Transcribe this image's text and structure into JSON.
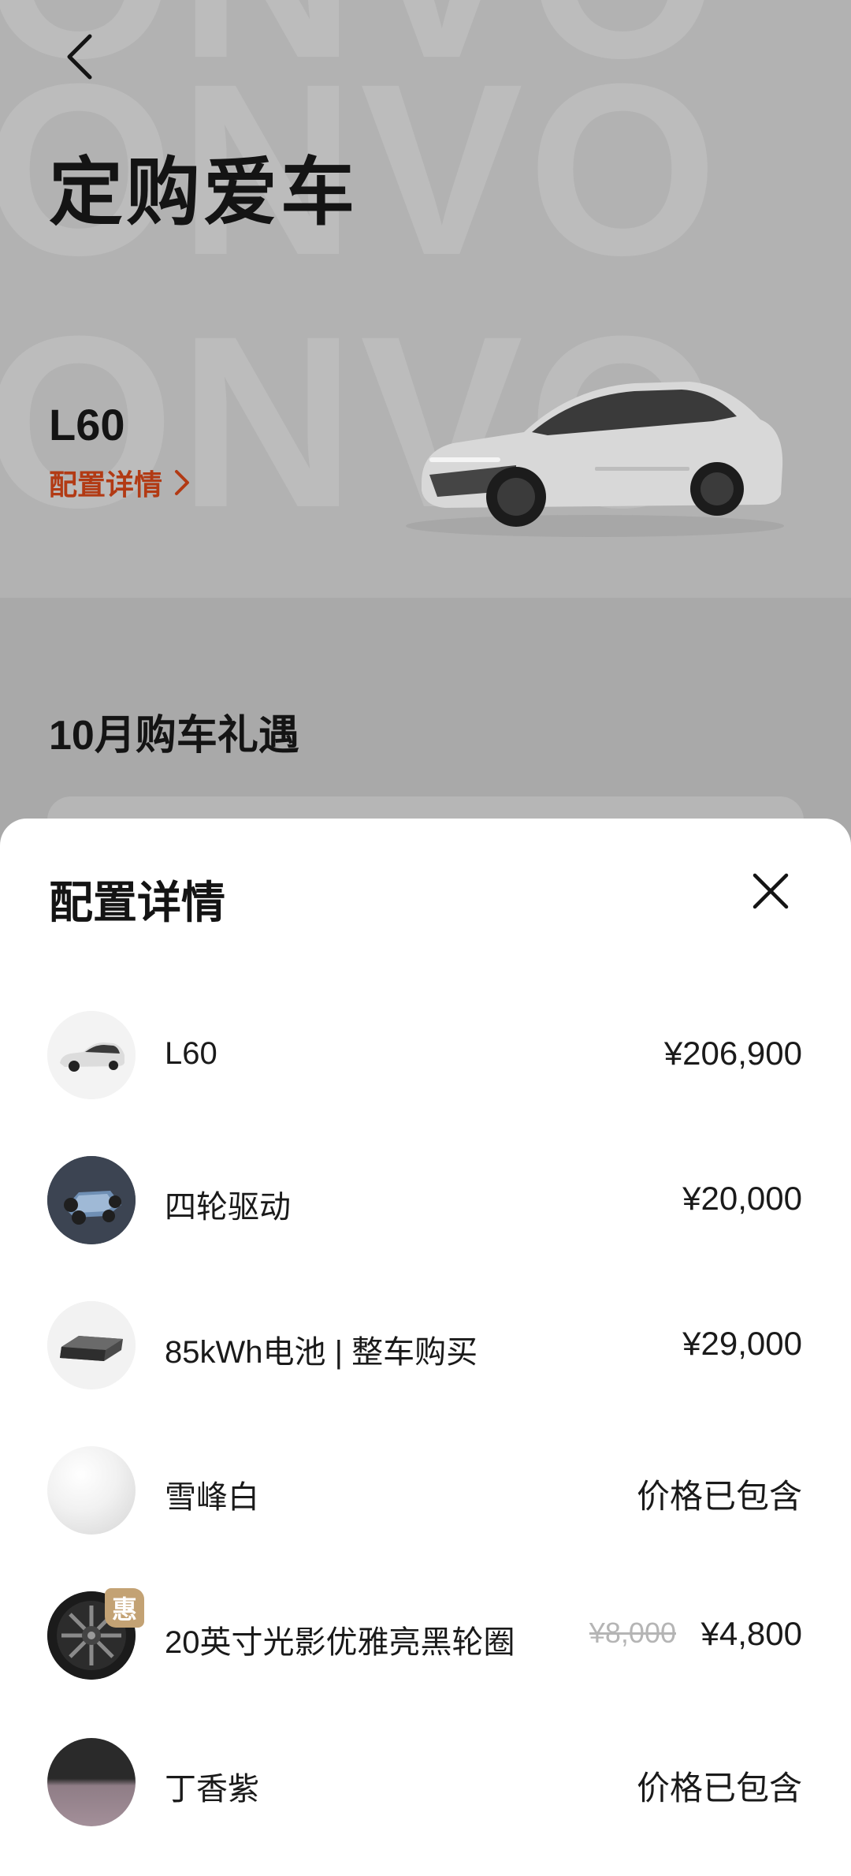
{
  "page": {
    "title": "定购爱车",
    "watermark": "ONVO",
    "model": "L60",
    "config_link": "配置详情",
    "promo_title": "10月购车礼遇"
  },
  "sheet": {
    "title": "配置详情",
    "items": [
      {
        "name": "L60",
        "price": "¥206,900",
        "thumb": "car-thumbnail"
      },
      {
        "name": "四轮驱动",
        "price": "¥20,000",
        "thumb": "chassis-thumbnail"
      },
      {
        "name": "85kWh电池 | 整车购买",
        "price": "¥29,000",
        "thumb": "battery-thumbnail"
      },
      {
        "name": "雪峰白",
        "price": "价格已包含",
        "thumb": "white-swatch"
      },
      {
        "name": "20英寸光影优雅亮黑轮圈",
        "old_price": "¥8,000",
        "price": "¥4,800",
        "badge": "惠",
        "thumb": "wheel-thumbnail"
      },
      {
        "name": "丁香紫",
        "price": "价格已包含",
        "thumb": "interior-swatch"
      }
    ]
  },
  "colors": {
    "accent": "#b23a14",
    "badge": "#c3a274",
    "overlay": "#a9a9a9"
  }
}
